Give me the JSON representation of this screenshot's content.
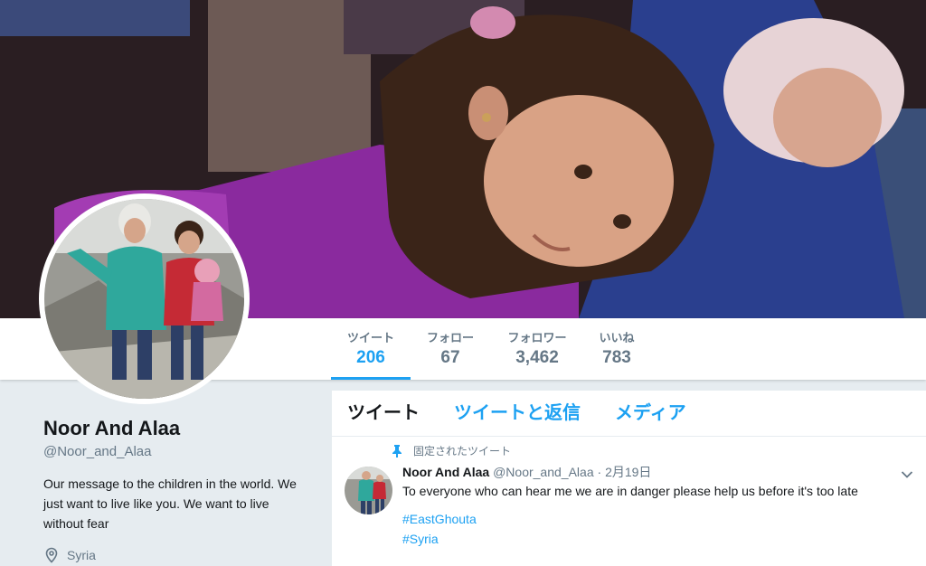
{
  "banner": {
    "alt": ""
  },
  "stats": [
    {
      "label": "ツイート",
      "value": "206",
      "active": true
    },
    {
      "label": "フォロー",
      "value": "67",
      "active": false
    },
    {
      "label": "フォロワー",
      "value": "3,462",
      "active": false
    },
    {
      "label": "いいね",
      "value": "783",
      "active": false
    }
  ],
  "profile": {
    "name": "Noor And Alaa",
    "handle": "@Noor_and_Alaa",
    "bio": "Our message to the children in the world. We just want to live like you. We want to live without fear",
    "location": "Syria",
    "location_icon": "location-pin-icon"
  },
  "timeline": {
    "tabs": [
      "ツイート",
      "ツイートと返信",
      "メディア"
    ]
  },
  "tweet": {
    "pinned_label": "固定されたツイート",
    "pin_icon": "pin-icon",
    "author_name": "Noor And Alaa",
    "author_handle": "@Noor_and_Alaa",
    "separator": "·",
    "date": "2月19日",
    "text": "To everyone who can hear me we are in danger please help us before it's too late",
    "hashtags": [
      "#EastGhouta",
      "#Syria"
    ],
    "caret_icon": "chevron-down-icon"
  },
  "colors": {
    "accent": "#1da1f2",
    "secondary_text": "#657786",
    "primary_text": "#14171a",
    "background": "#e6ecf0"
  }
}
